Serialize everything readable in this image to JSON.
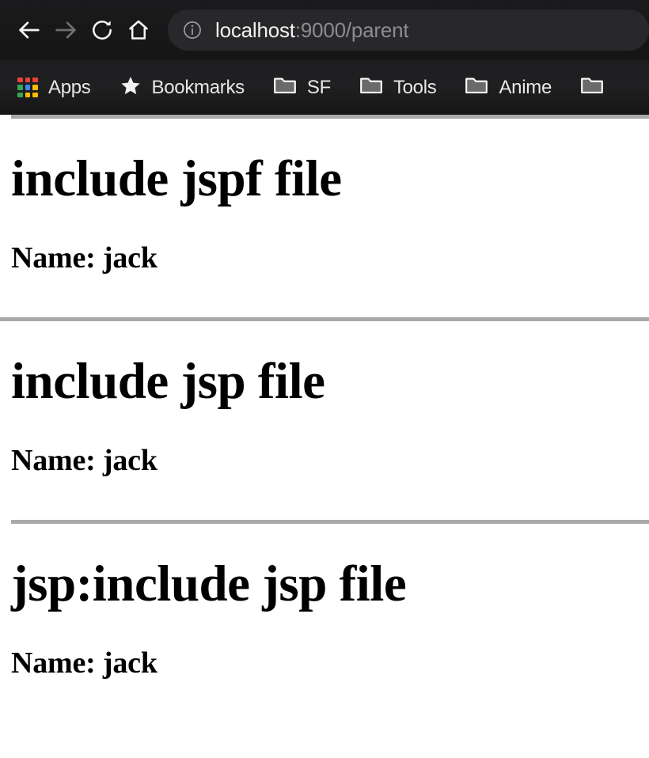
{
  "browser": {
    "toolbar": {
      "back_label": "Back",
      "forward_label": "Forward",
      "reload_label": "Reload",
      "home_label": "Home",
      "security_icon": "info-circle-icon",
      "url_host": "localhost",
      "url_rest": ":9000/parent",
      "url_full": "localhost:9000/parent"
    },
    "bookmarks": {
      "items": [
        {
          "label": "Apps",
          "icon": "apps-grid-icon"
        },
        {
          "label": "Bookmarks",
          "icon": "star-icon"
        },
        {
          "label": "SF",
          "icon": "folder-icon"
        },
        {
          "label": "Tools",
          "icon": "folder-icon"
        },
        {
          "label": "Anime",
          "icon": "folder-icon"
        },
        {
          "label": "",
          "icon": "folder-icon"
        }
      ]
    },
    "colors": {
      "chrome_bg": "#1c1c1e",
      "omnibox_bg": "#28282b",
      "url_host_color": "#f1f1f1",
      "url_rest_color": "#8d8d8f",
      "label_color": "#e8e8e8",
      "disabled_icon": "#6f6f71"
    }
  },
  "page": {
    "background": "#ffffff",
    "rule_color": "#a9a9a9",
    "sections": [
      {
        "heading": "include jspf file",
        "line": "Name: jack"
      },
      {
        "heading": "include jsp file",
        "line": "Name: jack"
      },
      {
        "heading": "jsp:include jsp file",
        "line": "Name: jack"
      }
    ]
  },
  "apps_icon_colors": [
    "#ea4335",
    "#ea4335",
    "#ea4335",
    "#34a853",
    "#4285f4",
    "#fbbc05",
    "#34a853",
    "#fbbc05",
    "#fbbc05"
  ]
}
